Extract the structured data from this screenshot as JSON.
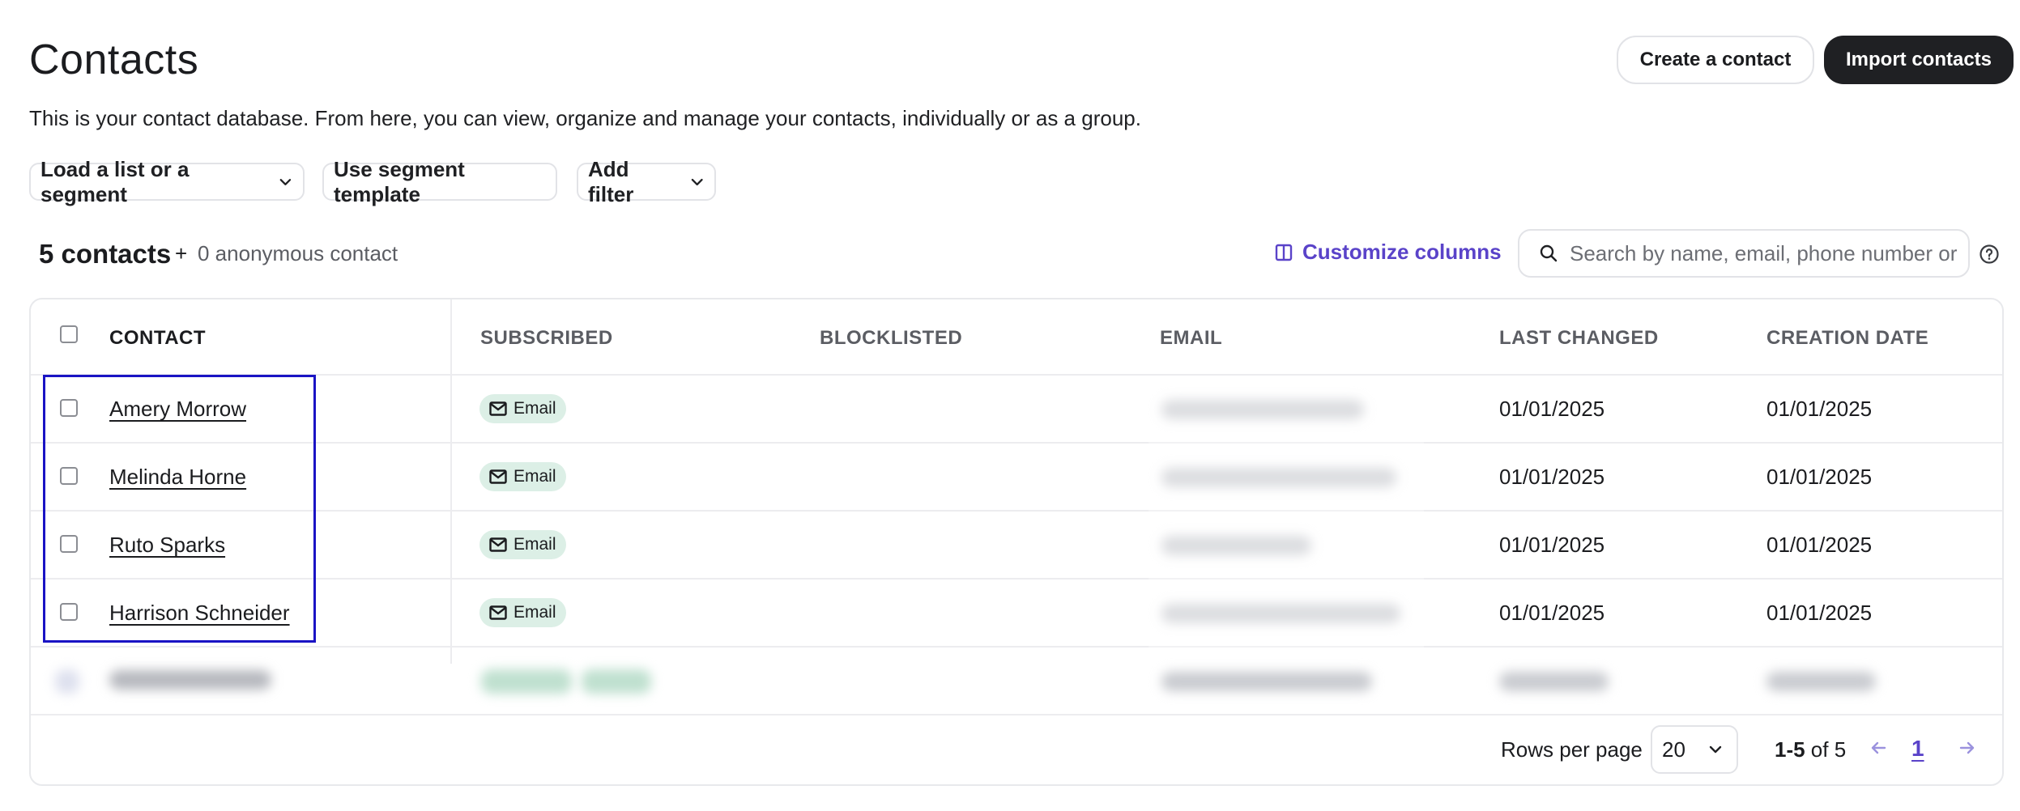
{
  "header": {
    "title": "Contacts",
    "description": "This is your contact database. From here, you can view, organize and manage your contacts, individually or as a group.",
    "create_button": "Create a contact",
    "import_button": "Import contacts"
  },
  "filters": {
    "load_list": "Load a list or a segment",
    "segment_template": "Use segment template",
    "add_filter": "Add filter"
  },
  "summary": {
    "count": "5 contacts",
    "plus": "+",
    "anonymous": "0 anonymous contact",
    "customize_columns": "Customize columns",
    "search_placeholder": "Search by name, email, phone number or e"
  },
  "table": {
    "columns": [
      "CONTACT",
      "SUBSCRIBED",
      "BLOCKLISTED",
      "EMAIL",
      "LAST CHANGED",
      "CREATION DATE"
    ],
    "rows": [
      {
        "name": "Amery Morrow",
        "subscribed": "Email",
        "last_changed": "01/01/2025",
        "creation_date": "01/01/2025"
      },
      {
        "name": "Melinda Horne",
        "subscribed": "Email",
        "last_changed": "01/01/2025",
        "creation_date": "01/01/2025"
      },
      {
        "name": "Ruto Sparks",
        "subscribed": "Email",
        "last_changed": "01/01/2025",
        "creation_date": "01/01/2025"
      },
      {
        "name": "Harrison Schneider",
        "subscribed": "Email",
        "last_changed": "01/01/2025",
        "creation_date": "01/01/2025"
      }
    ]
  },
  "pagination": {
    "rows_per_page_label": "Rows per page",
    "rows_per_page_value": "20",
    "range_bold": "1-5",
    "range_rest": " of 5",
    "current_page": "1"
  },
  "colors": {
    "accent": "#5a43c9",
    "primary_button": "#1f2023",
    "badge_bg": "#dcefe6",
    "selection_outline": "#1a13c4"
  },
  "icons": {
    "customize": "columns-icon",
    "search": "search-icon",
    "help": "help-circle-icon",
    "badge": "mail-icon",
    "chevron": "chevron-down-icon",
    "prev": "arrow-left-icon",
    "next": "arrow-right-icon"
  }
}
